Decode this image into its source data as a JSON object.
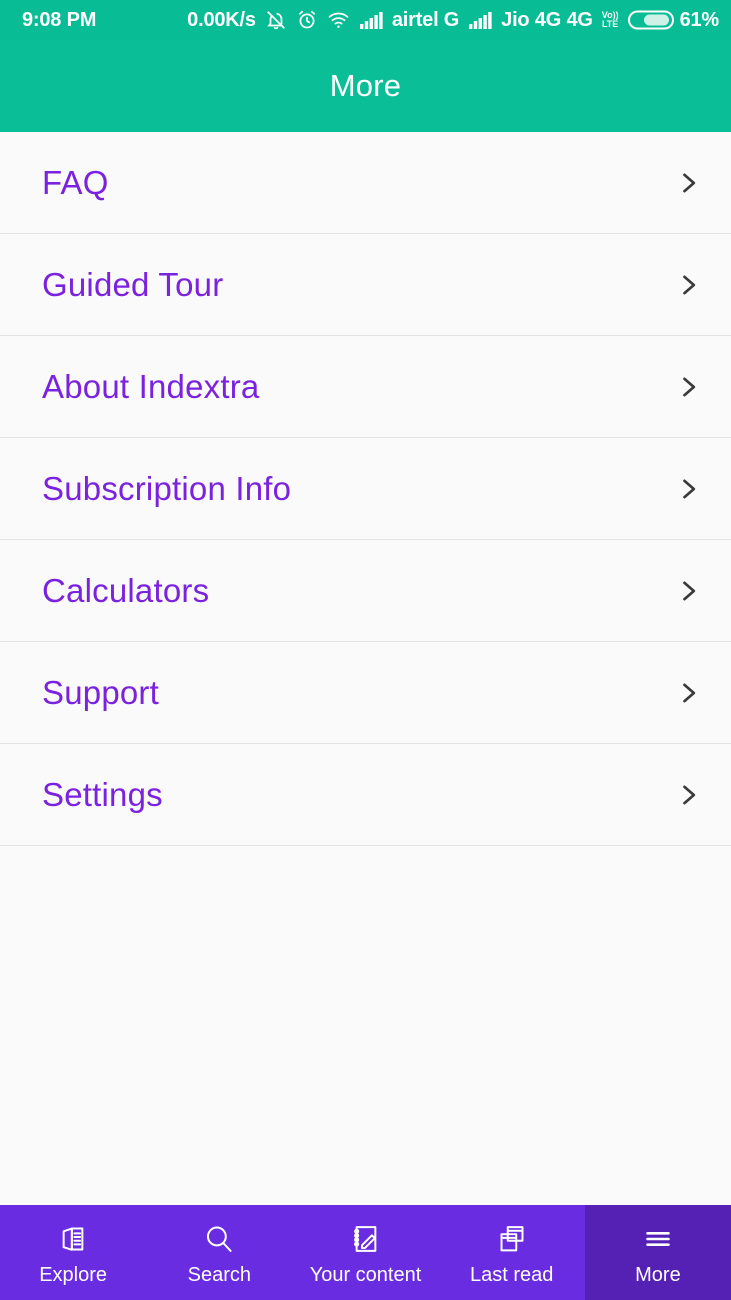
{
  "statusbar": {
    "clock": "9:08 PM",
    "net_rate": "0.00K/s",
    "icons_left": [
      "bell-mute-icon",
      "alarm-clock-icon",
      "wifi-icon"
    ],
    "sim1": {
      "signal_icon": "signal-bars-icon",
      "carrier": "airtel G"
    },
    "sim2": {
      "signal_icon": "signal-bars-icon",
      "carrier": "Jio 4G 4G"
    },
    "volte": {
      "line1": "Vo))",
      "line2": "LTE"
    },
    "battery": {
      "icon": "battery-icon",
      "percent": "61%",
      "level": 61
    }
  },
  "appbar": {
    "title": "More",
    "background": "#0ABF97",
    "text_color": "#FFFFFF"
  },
  "colors": {
    "teal": "#0ABF97",
    "purple_text": "#7B22DE",
    "nav_purple": "#6A2CE0",
    "nav_active_purple": "#5520B4",
    "page_bg": "#FAFAFA",
    "divider": "#E4E4E4",
    "chevron": "#3A3A3A"
  },
  "menu": {
    "items": [
      {
        "label": "FAQ",
        "chevron": "chevron-right-icon"
      },
      {
        "label": "Guided Tour",
        "chevron": "chevron-right-icon"
      },
      {
        "label": "About Indextra",
        "chevron": "chevron-right-icon"
      },
      {
        "label": "Subscription Info",
        "chevron": "chevron-right-icon"
      },
      {
        "label": "Calculators",
        "chevron": "chevron-right-icon"
      },
      {
        "label": "Support",
        "chevron": "chevron-right-icon"
      },
      {
        "label": "Settings",
        "chevron": "chevron-right-icon"
      }
    ]
  },
  "bottomnav": {
    "items": [
      {
        "label": "Explore",
        "icon": "book-open-icon",
        "active": false
      },
      {
        "label": "Search",
        "icon": "search-icon",
        "active": false
      },
      {
        "label": "Your content",
        "icon": "notebook-pencil-icon",
        "active": false
      },
      {
        "label": "Last read",
        "icon": "windows-stack-icon",
        "active": false
      },
      {
        "label": "More",
        "icon": "hamburger-menu-icon",
        "active": true
      }
    ]
  }
}
